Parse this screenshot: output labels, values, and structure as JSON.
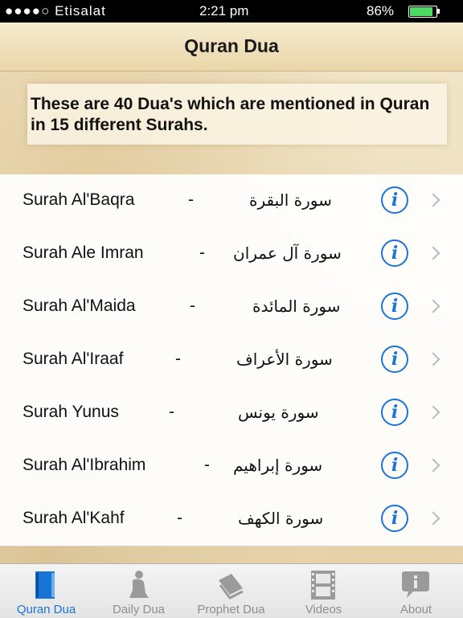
{
  "status_bar": {
    "carrier": "●●●●○ Etisalat",
    "time": "2:21 pm",
    "battery": "86%",
    "battery_level": 0.86
  },
  "nav": {
    "title": "Quran Dua"
  },
  "intro": {
    "text": "These are 40 Dua's which are mentioned in Quran in 15 different Surahs."
  },
  "surahs": [
    {
      "english": "Surah Al'Baqra",
      "arabic": "سورة البقرة"
    },
    {
      "english": "Surah Ale Imran",
      "arabic": "سورة آل عمران"
    },
    {
      "english": "Surah Al'Maida",
      "arabic": "سورة المائدة"
    },
    {
      "english": "Surah Al'Iraaf",
      "arabic": "سورة الأعراف"
    },
    {
      "english": "Surah Yunus",
      "arabic": "سورة يونس"
    },
    {
      "english": "Surah Al'Ibrahim",
      "arabic": "سورة إبراهيم"
    },
    {
      "english": "Surah Al'Kahf",
      "arabic": "سورة الكهف"
    }
  ],
  "row_separator": "-",
  "info_glyph": "i",
  "tabs": [
    {
      "label": "Quran Dua",
      "icon": "quran-book-icon",
      "active": true
    },
    {
      "label": "Daily Dua",
      "icon": "praying-person-icon",
      "active": false
    },
    {
      "label": "Prophet Dua",
      "icon": "open-book-icon",
      "active": false
    },
    {
      "label": "Videos",
      "icon": "film-strip-icon",
      "active": false
    },
    {
      "label": "About",
      "icon": "info-bubble-icon",
      "active": false
    }
  ],
  "colors": {
    "accent": "#1a74d6",
    "inactive_tab": "#8e8e8e",
    "parchment": "#efe2c2"
  }
}
